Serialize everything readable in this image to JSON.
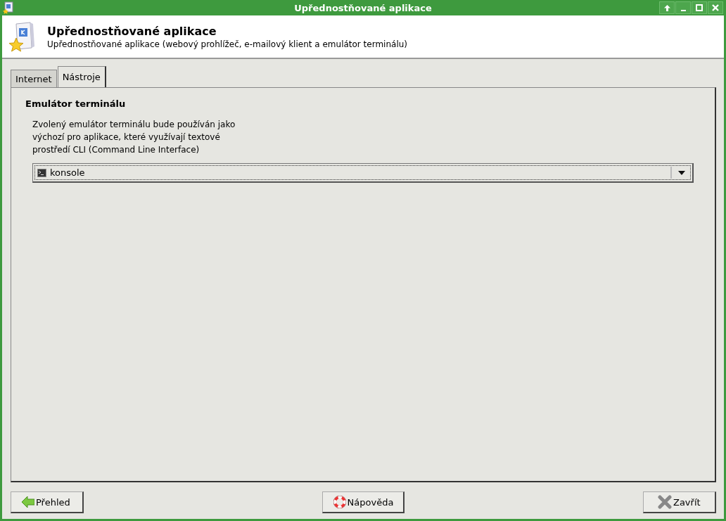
{
  "window": {
    "title": "Upřednostňované aplikace"
  },
  "header": {
    "title": "Upřednostňované aplikace",
    "subtitle": "Upřednostňované aplikace (webový prohlížeč, e-mailový klient a emulátor terminálu)"
  },
  "tabs": [
    {
      "label": "Internet",
      "selected": false
    },
    {
      "label": "Nástroje",
      "selected": true
    }
  ],
  "section": {
    "title": "Emulátor terminálu",
    "description": "Zvolený emulátor terminálu bude používán jako\nvýchozí pro aplikace, které využívají textové\nprostředí CLI (Command Line Interface)",
    "dropdown": {
      "value": "konsole"
    }
  },
  "buttons": [
    {
      "kind": "back",
      "label": "Přehled"
    },
    {
      "kind": "help",
      "label": "Nápověda"
    },
    {
      "kind": "close",
      "label": "Zavřít"
    }
  ]
}
